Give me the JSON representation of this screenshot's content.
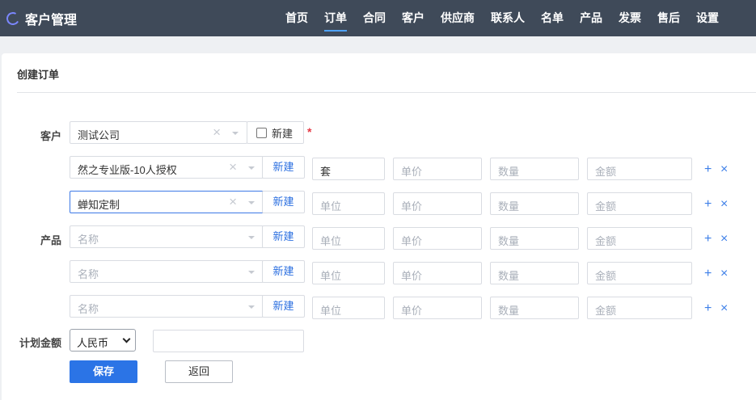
{
  "app": {
    "title": "客户管理"
  },
  "nav": [
    {
      "label": "首页",
      "active": false
    },
    {
      "label": "订单",
      "active": true
    },
    {
      "label": "合同",
      "active": false
    },
    {
      "label": "客户",
      "active": false
    },
    {
      "label": "供应商",
      "active": false
    },
    {
      "label": "联系人",
      "active": false
    },
    {
      "label": "名单",
      "active": false
    },
    {
      "label": "产品",
      "active": false
    },
    {
      "label": "发票",
      "active": false
    },
    {
      "label": "售后",
      "active": false
    },
    {
      "label": "设置",
      "active": false
    }
  ],
  "form": {
    "title": "创建订单",
    "customer": {
      "label": "客户",
      "value": "测试公司",
      "new_checkbox_label": "新建",
      "checked": false,
      "required_mark": "*"
    },
    "product_label": "产品",
    "new_button_label": "新建",
    "placeholders": {
      "name": "名称",
      "unit": "单位",
      "price": "单价",
      "qty": "数量",
      "amount": "金额"
    },
    "products": [
      {
        "name": "然之专业版-10人授权",
        "unit": "套",
        "price": "",
        "qty": "",
        "amount": ""
      },
      {
        "name": "蝉知定制",
        "unit": "",
        "price": "",
        "qty": "",
        "amount": ""
      },
      {
        "name": "",
        "unit": "",
        "price": "",
        "qty": "",
        "amount": ""
      },
      {
        "name": "",
        "unit": "",
        "price": "",
        "qty": "",
        "amount": ""
      },
      {
        "name": "",
        "unit": "",
        "price": "",
        "qty": "",
        "amount": ""
      }
    ],
    "row_actions": {
      "add": "+",
      "remove": "×"
    },
    "plan_amount": {
      "label": "计划金额",
      "currency": "人民币",
      "value": ""
    },
    "save_label": "保存",
    "back_label": "返回"
  },
  "colors": {
    "topbar": "#3f4a59",
    "accent": "#2b74e6",
    "required": "#e53945"
  }
}
